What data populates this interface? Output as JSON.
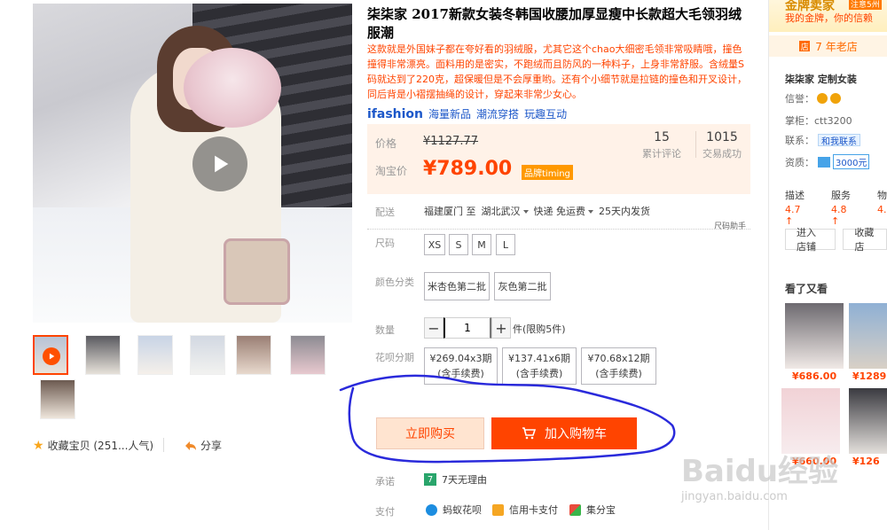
{
  "product": {
    "title": "柒柒家 2017新款女装冬韩国收腰加厚显瘦中长款超大毛领羽绒服潮",
    "subtitle": "这款就是外国妹子都在夸好看的羽绒服，尤其它这个chao大细密毛领非常吸睛哦，撞色撞得非常漂亮。面料用的是密实，不跑绒而且防风的一种料子，上身非常舒服。含绒量S码就达到了220克，超保暖但是不会厚重哟。还有个小细节就是拉链的撞色和开叉设计，同后背是小褶摆抽绳的设计，穿起来非常少女心。",
    "ifashion": {
      "logo": "ifashion",
      "tags": [
        "海量新品",
        "潮流穿搭",
        "玩趣互动"
      ]
    }
  },
  "price": {
    "price_label": "价格",
    "original": "¥1127.77",
    "taobao_label": "淘宝价",
    "sale": "¥789.00",
    "brand_tag": "品牌timing",
    "reviews": {
      "value": "15",
      "label": "累计评论"
    },
    "sales": {
      "value": "1015",
      "label": "交易成功"
    }
  },
  "shipping": {
    "label": "配送",
    "from": "福建厦门 至",
    "to": "湖北武汉",
    "method": "快递 免运费",
    "days": "25天内发货",
    "size_helper": "尺码助手"
  },
  "size": {
    "label": "尺码",
    "options": [
      "XS",
      "S",
      "M",
      "L"
    ]
  },
  "color": {
    "label": "颜色分类",
    "options": [
      "米杏色第二批",
      "灰色第二批"
    ]
  },
  "quantity": {
    "label": "数量",
    "value": "1",
    "minus": "−",
    "plus": "+",
    "limit": "件(限购5件)"
  },
  "installment": {
    "label": "花呗分期",
    "options": [
      {
        "amount": "¥269.04x3期",
        "note": "(含手续费)"
      },
      {
        "amount": "¥137.41x6期",
        "note": "(含手续费)"
      },
      {
        "amount": "¥70.68x12期",
        "note": "(含手续费)"
      }
    ]
  },
  "actions": {
    "buy_now": "立即购买",
    "add_cart": "加入购物车"
  },
  "promise": {
    "label": "承诺",
    "seven": "7",
    "text": "7天无理由"
  },
  "payment": {
    "label": "支付",
    "methods": [
      "蚂蚁花呗",
      "信用卡支付",
      "集分宝"
    ]
  },
  "gallery": {
    "collect": "收藏宝贝 (251...人气)",
    "share": "分享"
  },
  "store": {
    "gold": "金牌卖家",
    "gold_badge": "注意5州",
    "trust": "我的金牌，你的信赖",
    "years": "7 年老店",
    "years_badge": "店",
    "name": "柒柒家 定制女装",
    "credit_label": "信誉：",
    "keeper_label": "掌柜：",
    "keeper": "ctt3200",
    "contact_label": "联系：",
    "contact_btn": "和我联系",
    "qual_label": "资质：",
    "deposit": "3000元",
    "scores": [
      {
        "label": "描述",
        "value": "4.7 ↑"
      },
      {
        "label": "服务",
        "value": "4.8 ↑"
      },
      {
        "label": "物",
        "value": "4."
      }
    ],
    "enter_btn": "进入店铺",
    "fav_btn": "收藏店",
    "seen_title": "看了又看",
    "recs": [
      "¥686.00",
      "¥1289",
      "¥660.00",
      "¥126"
    ]
  },
  "watermark": {
    "main": "Baidu经验",
    "sub": "jingyan.baidu.com"
  },
  "colors": {
    "accent": "#ff4400",
    "price_bg": "#fff2e8",
    "annotation": "#2a2adb"
  }
}
